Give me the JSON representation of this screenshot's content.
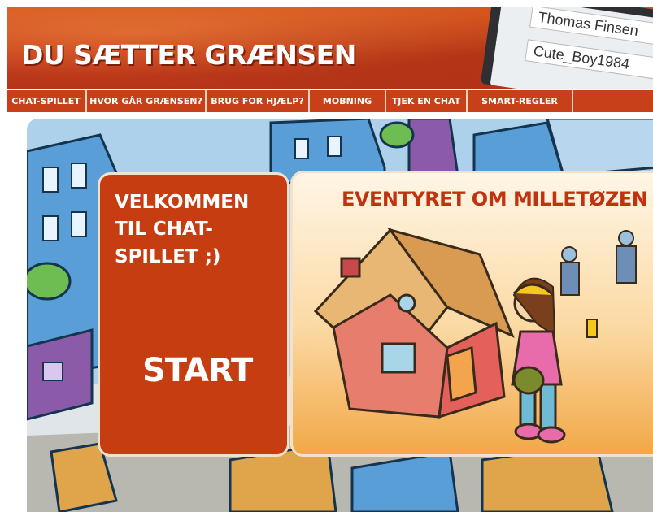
{
  "site": {
    "title": "DU SÆTTER GRÆNSEN"
  },
  "header_screen": {
    "field1": "Thomas Finsen",
    "field2": "Cute_Boy1984"
  },
  "nav": {
    "items": [
      {
        "label": "CHAT-SPILLET"
      },
      {
        "label": "HVOR GÅR GRÆNSEN?"
      },
      {
        "label": "BRUG FOR HJÆLP?"
      },
      {
        "label": "MOBNING"
      },
      {
        "label": "TJEK EN CHAT"
      },
      {
        "label": "SMART-REGLER"
      },
      {
        "label": ""
      }
    ]
  },
  "welcome": {
    "heading": "VELKOMMEN TIL CHAT-SPILLET ;)",
    "start_label": "START"
  },
  "story": {
    "title": "EVENTYRET OM MILLETØZEN"
  },
  "colors": {
    "primary_red": "#c8401a",
    "panel_red": "#c73d12",
    "title_red": "#c0330f"
  },
  "icons": {
    "cursor": "hand-cursor-icon"
  }
}
